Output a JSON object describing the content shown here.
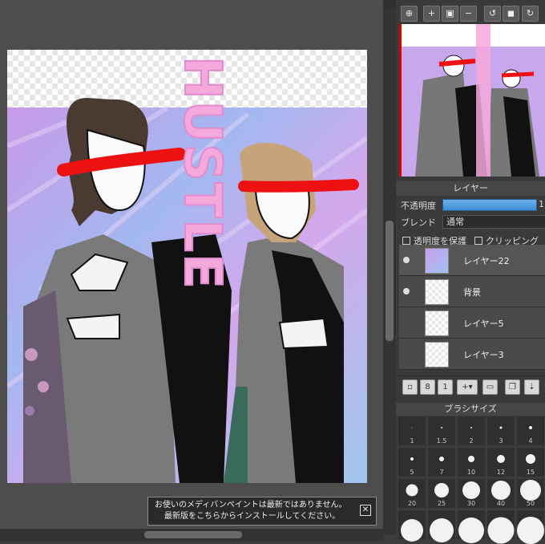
{
  "notice": {
    "line1": "お使いのメディバンペイントは最新ではありません。",
    "line2": "最新版をこちらからインストールしてください。",
    "close": "✕"
  },
  "artwork": {
    "text": "HUSTLE"
  },
  "navigator": {
    "buttons": [
      "zoom-fit-icon",
      "zoom-in-icon",
      "fit-screen-icon",
      "zoom-out-icon",
      "rotate-left-icon",
      "fullscreen-icon",
      "rotate-right-icon"
    ]
  },
  "layer_panel": {
    "title": "レイヤー",
    "opacity_label": "不透明度",
    "opacity_value": "1",
    "opacity": 1.0,
    "blend_label": "ブレンド",
    "blend_value": "通常",
    "protect_alpha": "透明度を保護",
    "clipping": "クリッピング",
    "layers": [
      {
        "name": "レイヤー22",
        "visible": true
      },
      {
        "name": "背景",
        "visible": true
      },
      {
        "name": "レイヤー5",
        "visible": false
      },
      {
        "name": "レイヤー3",
        "visible": false
      }
    ]
  },
  "brush_panel": {
    "title": "ブラシサイズ",
    "sizes": [
      "1",
      "1.5",
      "2",
      "3",
      "4",
      "5",
      "7",
      "10",
      "12",
      "15",
      "20",
      "25",
      "30",
      "40",
      "50"
    ]
  },
  "colors": {
    "accent": "#3d8fd8",
    "panel": "#3a3a3a",
    "canvas_bg": "#4d4d4d"
  }
}
